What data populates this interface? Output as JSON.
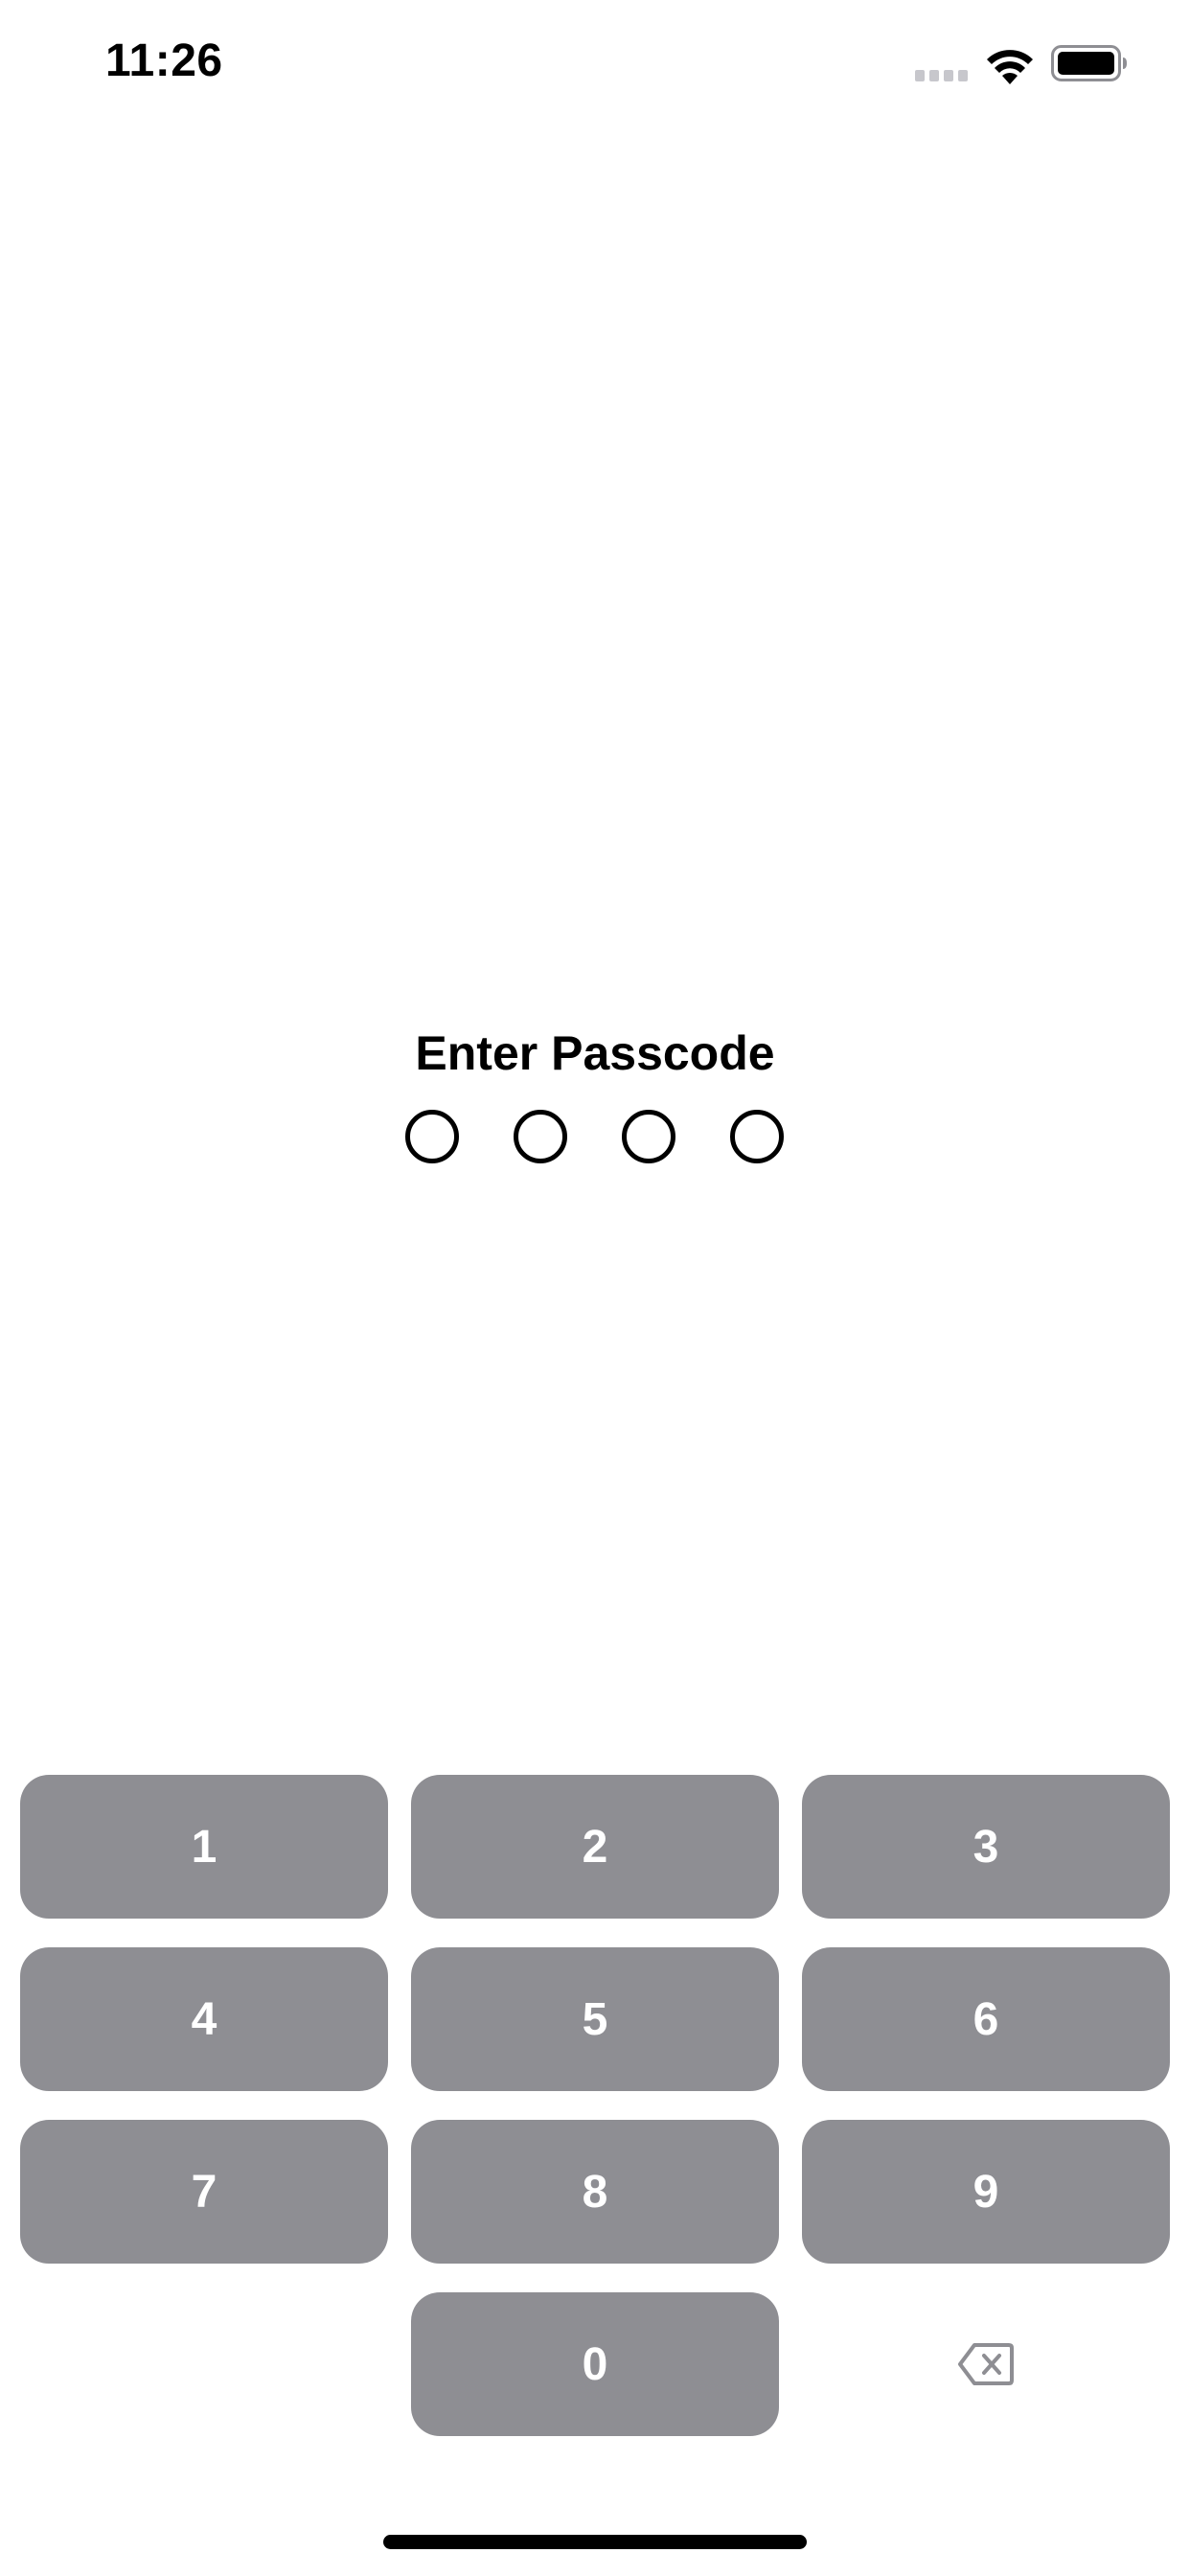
{
  "status_bar": {
    "time": "11:26",
    "icons": [
      "cellular-signal-icon",
      "wifi-icon",
      "battery-icon"
    ]
  },
  "passcode": {
    "title": "Enter Passcode",
    "length": 4,
    "entered": 0
  },
  "keypad": {
    "keys": [
      "1",
      "2",
      "3",
      "4",
      "5",
      "6",
      "7",
      "8",
      "9",
      "0"
    ],
    "delete_icon": "delete-backspace-icon"
  },
  "colors": {
    "key_background": "#8e8e93",
    "key_text": "#ffffff",
    "text": "#000000",
    "background": "#ffffff"
  }
}
